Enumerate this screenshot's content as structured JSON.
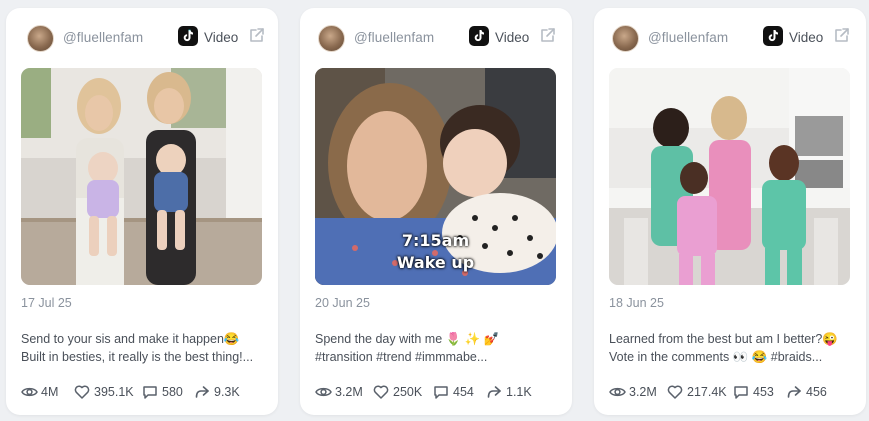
{
  "cards": [
    {
      "username": "@fluellenfam",
      "platform": "Video",
      "date": "17 Jul 25",
      "caption_line1": "Send to your sis and make it happen😂",
      "caption_line2": "Built in besties, it really is the best thing!...",
      "overlay_line1": "",
      "overlay_line2": "",
      "views": "4M",
      "likes": "395.1K",
      "comments": "580",
      "shares": "9.3K"
    },
    {
      "username": "@fluellenfam",
      "platform": "Video",
      "date": "20 Jun 25",
      "caption_line1": "Spend the day with me 🌷 ✨ 💅",
      "caption_line2": "#transition #trend #immmabe...",
      "overlay_line1": "7:15am",
      "overlay_line2": "Wake up",
      "views": "3.2M",
      "likes": "250K",
      "comments": "454",
      "shares": "1.1K"
    },
    {
      "username": "@fluellenfam",
      "platform": "Video",
      "date": "18 Jun 25",
      "caption_line1": "Learned from the best but am I better?😜",
      "caption_line2": "Vote in the comments 👀 😂 #braids...",
      "overlay_line1": "",
      "overlay_line2": "",
      "views": "3.2M",
      "likes": "217.4K",
      "comments": "453",
      "shares": "456"
    }
  ],
  "icons": {
    "platform": "tiktok-icon",
    "open": "external-link-icon",
    "views": "eye-icon",
    "likes": "heart-icon",
    "comments": "comment-icon",
    "shares": "share-icon"
  },
  "colors": {
    "background": "#eef0f3",
    "card": "#ffffff",
    "muted_text": "#8a929d",
    "body_text": "#4a5059"
  }
}
